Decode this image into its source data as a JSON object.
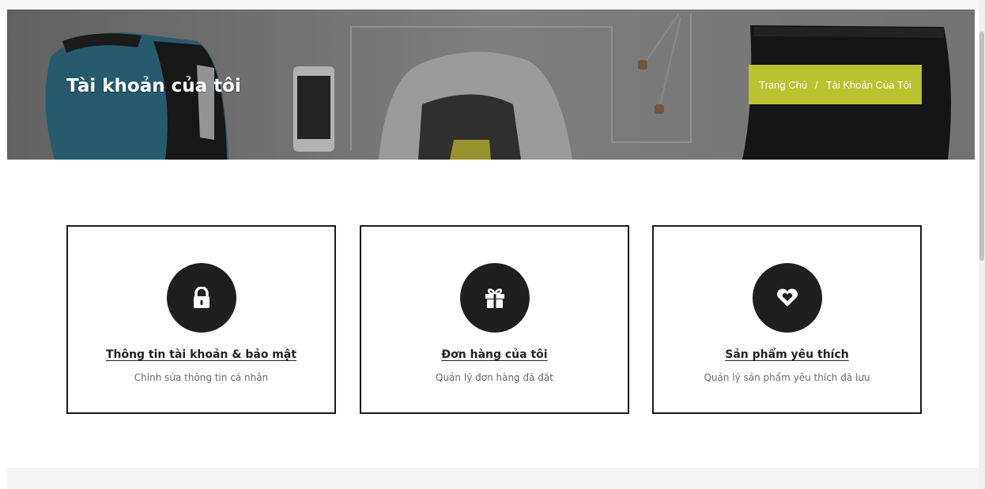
{
  "banner": {
    "title": "Tài khoản của tôi",
    "breadcrumb": {
      "home": "Trang Chủ",
      "separator": "/",
      "current": "Tài Khoản Của Tôi",
      "background_color": "#b9c22f"
    }
  },
  "cards": [
    {
      "icon": "lock-icon",
      "title": "Thông tin tài khoản & bảo mật",
      "description": "Chỉnh sửa thông tin cá nhân"
    },
    {
      "icon": "gift-icon",
      "title": "Đơn hàng của tôi",
      "description": "Quản lý đơn hàng đã đặt"
    },
    {
      "icon": "heart-icon",
      "title": "Sản phẩm yêu thích",
      "description": "Quản lý sản phẩm yêu thích đã lưu"
    }
  ],
  "colors": {
    "accent": "#b9c22f",
    "card_border": "#1b1b1b",
    "icon_circle": "#1f1f1f"
  }
}
